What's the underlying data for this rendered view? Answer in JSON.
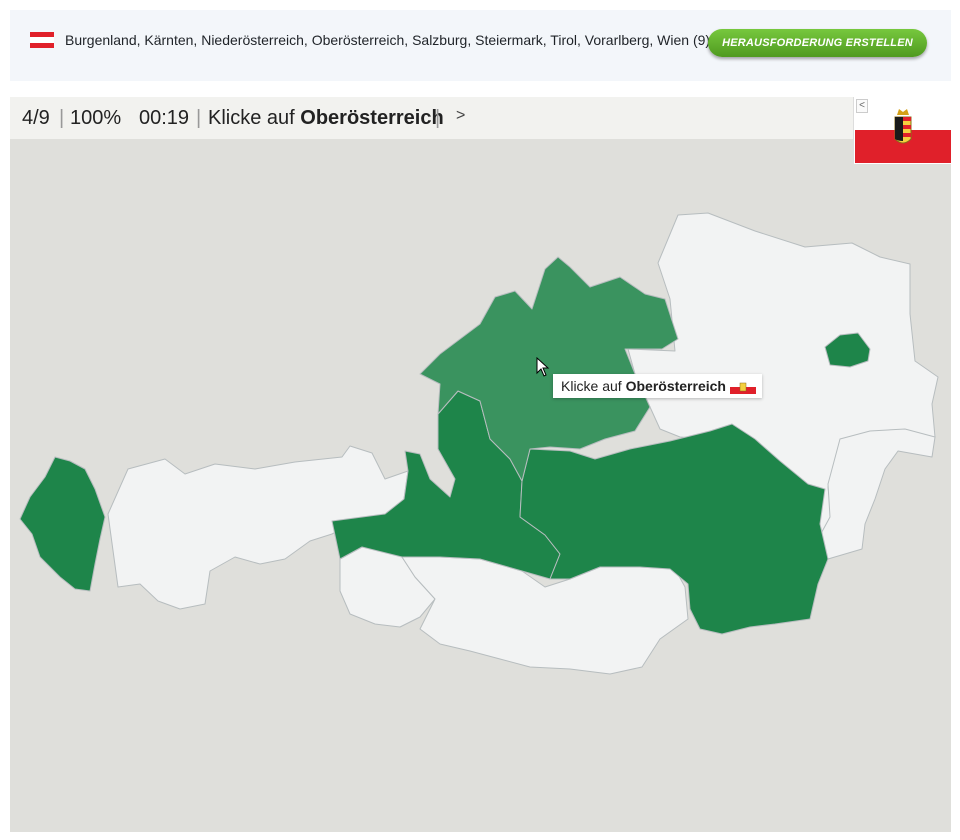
{
  "header": {
    "country_flag_icon": "austria-flag-icon",
    "regions_text": "Burgenland, Kärnten, Niederösterreich, Oberösterreich, Salzburg, Steiermark, Tirol, Vorarlberg, Wien (9)",
    "challenge_button": "HERAUSFORDERUNG ERSTELLEN"
  },
  "status": {
    "progress": "4/9",
    "accuracy": "100%",
    "timer": "00:19",
    "prompt_prefix": "Klicke auf ",
    "prompt_target": "Oberösterreich",
    "next_label": ">"
  },
  "flag_panel": {
    "collapse_label": "<",
    "flag_icon": "upper-austria-flag-icon"
  },
  "tooltip": {
    "prefix": "Klicke auf ",
    "target": "Oberösterreich",
    "flag_icon": "upper-austria-flag-icon"
  },
  "map": {
    "regions": [
      {
        "name": "Vorarlberg",
        "state": "solved"
      },
      {
        "name": "Tirol",
        "state": "unsolved"
      },
      {
        "name": "Salzburg",
        "state": "solved"
      },
      {
        "name": "Oberösterreich",
        "state": "highlighted"
      },
      {
        "name": "Niederösterreich",
        "state": "unsolved"
      },
      {
        "name": "Wien",
        "state": "solved"
      },
      {
        "name": "Burgenland",
        "state": "unsolved"
      },
      {
        "name": "Steiermark",
        "state": "solved"
      },
      {
        "name": "Kärnten",
        "state": "unsolved"
      }
    ]
  },
  "colors": {
    "solved": "#1e854a",
    "highlighted": "#3a935f",
    "unsolved": "#f2f3f3",
    "background": "#dfdfdb",
    "border": "#b7bdbf",
    "flag_red": "#e0202a"
  }
}
